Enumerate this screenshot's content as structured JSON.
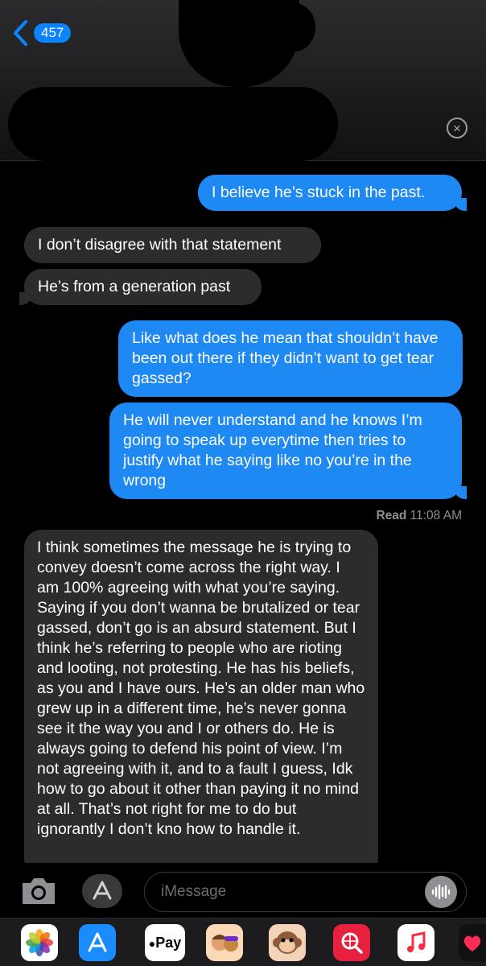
{
  "header": {
    "back_count": "457"
  },
  "messages": [
    {
      "id": "m1",
      "direction": "outgoing",
      "text": "I believe he’s stuck in the past."
    },
    {
      "id": "m2",
      "direction": "incoming",
      "text": "I don’t disagree with that statement"
    },
    {
      "id": "m3",
      "direction": "incoming",
      "text": "He’s from a generation past"
    },
    {
      "id": "m4",
      "direction": "outgoing",
      "text": "Like what does he mean that shouldn’t have been out there if they didn’t want to get tear gassed?"
    },
    {
      "id": "m5",
      "direction": "outgoing",
      "text": "He will never understand and he knows I’m going to speak up everytime then tries to justify what he saying like no you’re in the wrong"
    },
    {
      "id": "m6",
      "direction": "incoming",
      "text": "I think sometimes the message he is trying to convey doesn’t come across the right way. I am 100% agreeing with what you’re saying. Saying if you don’t wanna be brutalized or tear gassed, don’t go is an absurd statement. But I think he’s referring to people who are rioting and looting, not protesting. He has his beliefs, as you and I have ours. He’s an older man who grew up in a different time, he’s never gonna see it the way you and I or others do. He is always going to defend his point of view. I’m not agreeing with it, and to a fault I guess, Idk how to go about it other than paying it no mind at all. That’s not right for me to do but ignorantly I don’t kno how to handle it."
    }
  ],
  "receipt": {
    "label": "Read",
    "time": "11:08 AM"
  },
  "compose": {
    "placeholder": "iMessage"
  },
  "app_drawer": [
    {
      "name": "photos-icon"
    },
    {
      "name": "app-store-icon"
    },
    {
      "name": "apple-pay-icon",
      "label": "Pay"
    },
    {
      "name": "memoji-icon"
    },
    {
      "name": "animoji-monkey-icon"
    },
    {
      "name": "web-search-icon"
    },
    {
      "name": "music-icon"
    },
    {
      "name": "digital-touch-icon"
    }
  ],
  "colors": {
    "outgoing_bubble": "#1e88f3",
    "incoming_bubble": "#2c2c2e",
    "accent": "#0a84ff"
  }
}
